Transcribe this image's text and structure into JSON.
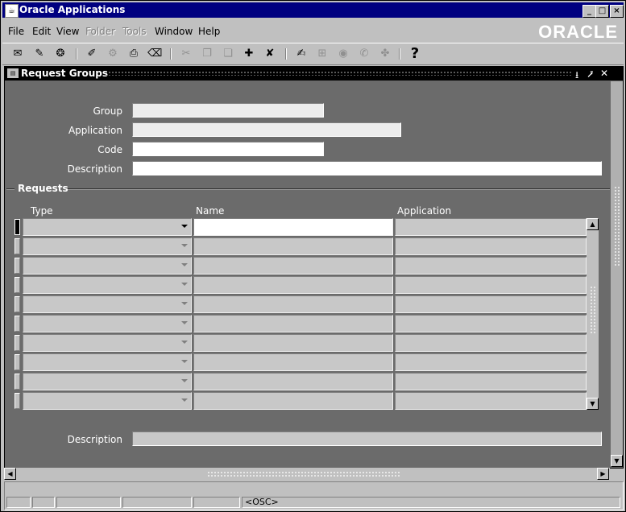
{
  "window": {
    "title": "Oracle Applications",
    "controls": [
      "_",
      "□",
      "×"
    ]
  },
  "menubar": {
    "items": [
      {
        "label": "File",
        "enabled": true
      },
      {
        "label": "Edit",
        "enabled": true
      },
      {
        "label": "View",
        "enabled": true
      },
      {
        "label": "Folder",
        "enabled": false
      },
      {
        "label": "Tools",
        "enabled": false
      },
      {
        "label": "Window",
        "enabled": true
      },
      {
        "label": "Help",
        "enabled": true
      }
    ],
    "logo": "ORACLE"
  },
  "toolbar": {
    "buttons": [
      {
        "name": "new-record-icon",
        "glyph": "✉",
        "enabled": true
      },
      {
        "name": "find-icon",
        "glyph": "✎",
        "enabled": true
      },
      {
        "name": "navigator-icon",
        "glyph": "❂",
        "enabled": true
      },
      {
        "name": "save-icon",
        "glyph": "✐",
        "enabled": true
      },
      {
        "name": "next-step-icon",
        "glyph": "⚙",
        "enabled": false
      },
      {
        "name": "print-icon",
        "glyph": "⎙",
        "enabled": true
      },
      {
        "name": "close-form-icon",
        "glyph": "⌫",
        "enabled": true
      },
      {
        "name": "cut-icon",
        "glyph": "✂",
        "enabled": false
      },
      {
        "name": "copy-icon",
        "glyph": "❐",
        "enabled": false
      },
      {
        "name": "paste-icon",
        "glyph": "❏",
        "enabled": false
      },
      {
        "name": "new-icon",
        "glyph": "✚",
        "enabled": true
      },
      {
        "name": "delete-icon",
        "glyph": "✘",
        "enabled": true
      },
      {
        "name": "edit-field-icon",
        "glyph": "✍",
        "enabled": true
      },
      {
        "name": "zoom-icon",
        "glyph": "⊞",
        "enabled": false
      },
      {
        "name": "translations-icon",
        "glyph": "◉",
        "enabled": false
      },
      {
        "name": "attachments-icon",
        "glyph": "✆",
        "enabled": false
      },
      {
        "name": "folder-tools-icon",
        "glyph": "✤",
        "enabled": false
      },
      {
        "name": "help-icon",
        "glyph": "?",
        "enabled": true
      }
    ]
  },
  "form": {
    "title": "Request Groups",
    "header_controls": [
      "⭳",
      "⭷",
      "✕"
    ],
    "fields": {
      "group": {
        "label": "Group",
        "value": ""
      },
      "application": {
        "label": "Application",
        "value": ""
      },
      "code": {
        "label": "Code",
        "value": ""
      },
      "description": {
        "label": "Description",
        "value": ""
      }
    },
    "requests": {
      "section_title": "Requests",
      "columns": {
        "type": "Type",
        "name": "Name",
        "application": "Application"
      },
      "rows": [
        {
          "type": "",
          "name": "",
          "application": ""
        },
        {
          "type": "",
          "name": "",
          "application": ""
        },
        {
          "type": "",
          "name": "",
          "application": ""
        },
        {
          "type": "",
          "name": "",
          "application": ""
        },
        {
          "type": "",
          "name": "",
          "application": ""
        },
        {
          "type": "",
          "name": "",
          "application": ""
        },
        {
          "type": "",
          "name": "",
          "application": ""
        },
        {
          "type": "",
          "name": "",
          "application": ""
        },
        {
          "type": "",
          "name": "",
          "application": ""
        },
        {
          "type": "",
          "name": "",
          "application": ""
        }
      ]
    },
    "footer_description": {
      "label": "Description",
      "value": ""
    }
  },
  "status": {
    "mode": "<OSC>"
  }
}
